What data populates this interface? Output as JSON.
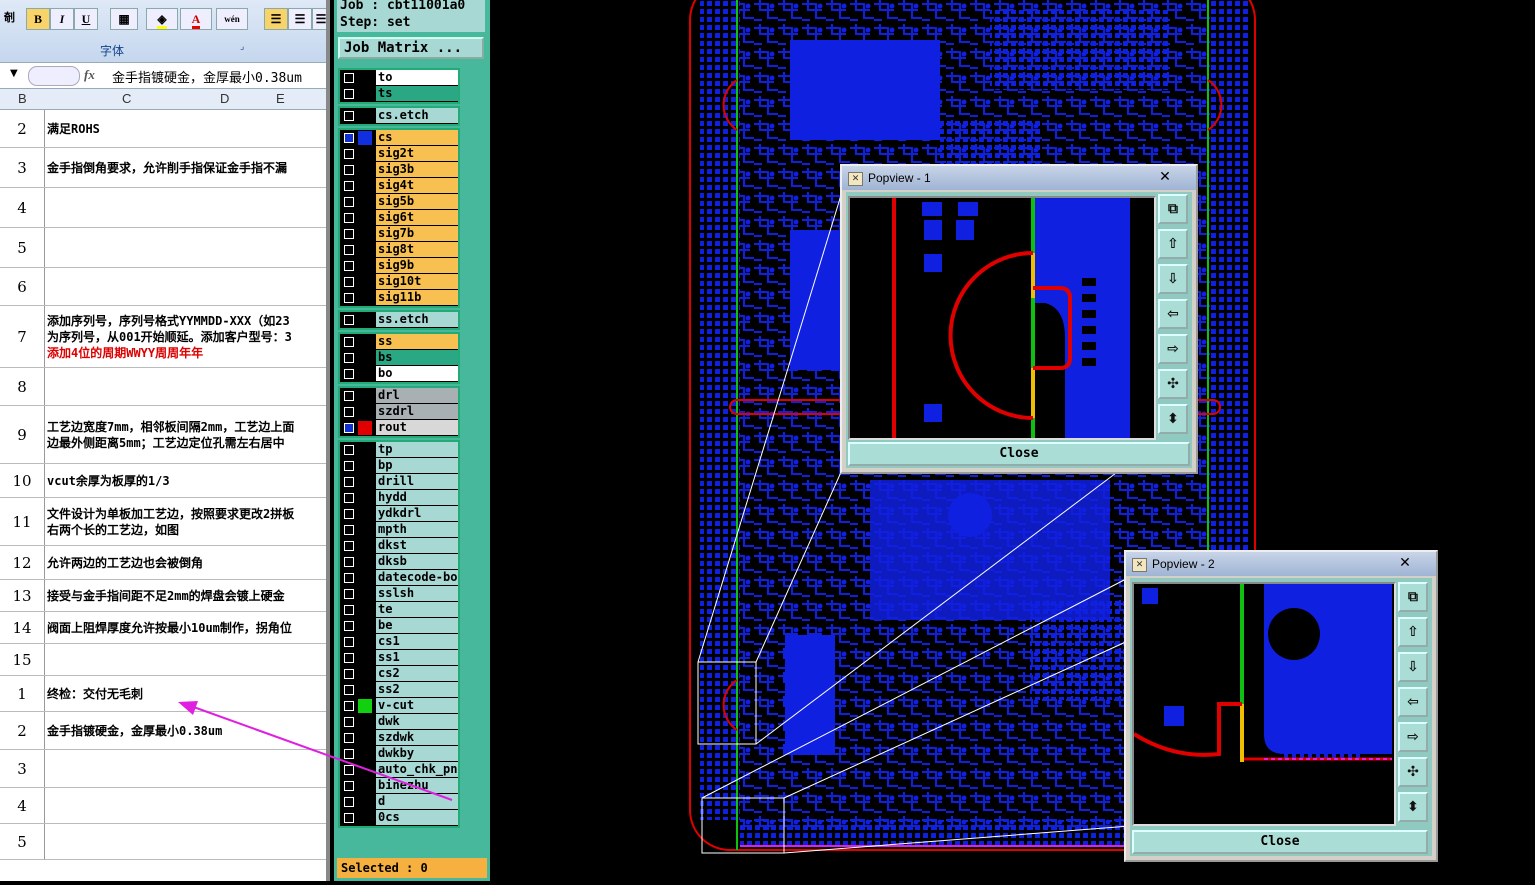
{
  "excel": {
    "ribbon": {
      "bold": "B",
      "italic": "I",
      "underline": "U",
      "font_color": "A",
      "phonetic": "wén",
      "group_font": "字体",
      "corner_label": "剞"
    },
    "formula_bar": {
      "fx": "fx",
      "value": "金手指镀硬金，金厚最小0.38um"
    },
    "columns": [
      "B",
      "C",
      "D",
      "E"
    ],
    "rows": [
      {
        "num": "2",
        "lines": [
          "满足ROHS"
        ]
      },
      {
        "num": "3",
        "lines": [
          "金手指倒角要求，允许削手指保证金手指不漏"
        ]
      },
      {
        "num": "4",
        "lines": [
          ""
        ]
      },
      {
        "num": "5",
        "lines": [
          ""
        ]
      },
      {
        "num": "6",
        "lines": [
          ""
        ]
      },
      {
        "num": "7",
        "lines": [
          "添加序列号，序列号格式YYMMDD-XXX（如23",
          "为序列号，从001开始顺延。添加客户型号：3"
        ],
        "red_line": "添加4位的周期WWYY周周年年"
      },
      {
        "num": "8",
        "lines": [
          ""
        ]
      },
      {
        "num": "9",
        "lines": [
          "工艺边宽度7mm，相邻板间隔2mm，工艺边上面",
          "边最外侧距离5mm；工艺边定位孔需左右居中"
        ]
      },
      {
        "num": "10",
        "lines": [
          "vcut余厚为板厚的1/3"
        ]
      },
      {
        "num": "11",
        "lines": [
          "文件设计为单板加工艺边，按照要求更改2拼板",
          "右两个长的工艺边，如图"
        ]
      },
      {
        "num": "12",
        "lines": [
          "允许两边的工艺边也会被倒角"
        ]
      },
      {
        "num": "13",
        "lines": [
          "接受与金手指间距不足2mm的焊盘会镀上硬金"
        ]
      },
      {
        "num": "14",
        "lines": [
          "阀面上阻焊厚度允许按最小10um制作，拐角位"
        ]
      },
      {
        "num": "15",
        "lines": [
          ""
        ]
      },
      {
        "num": "1",
        "lines": [
          "终检：交付无毛刺"
        ]
      },
      {
        "num": "2",
        "lines": [
          "金手指镀硬金，金厚最小0.38um"
        ]
      },
      {
        "num": "3",
        "lines": [
          ""
        ]
      },
      {
        "num": "4",
        "lines": [
          ""
        ]
      },
      {
        "num": "5",
        "lines": [
          ""
        ]
      }
    ]
  },
  "panel": {
    "job": "Job : cbt11001a0",
    "step": "Step: set",
    "job_matrix": "Job Matrix ...",
    "selected": "Selected : 0",
    "groups": [
      {
        "layers": [
          {
            "name": "to",
            "color": "#ffffff",
            "sw": ""
          },
          {
            "name": "ts",
            "color": "#2aa884",
            "sw": ""
          }
        ]
      },
      {
        "layers": [
          {
            "name": "cs.etch",
            "color": "#a7d8d4",
            "sw": ""
          }
        ]
      },
      {
        "layers": [
          {
            "name": "cs",
            "color": "#f8c050",
            "sw": "#1030e0",
            "checked": true
          },
          {
            "name": "sig2t",
            "color": "#f8c050",
            "sw": ""
          },
          {
            "name": "sig3b",
            "color": "#f8c050",
            "sw": ""
          },
          {
            "name": "sig4t",
            "color": "#f8c050",
            "sw": ""
          },
          {
            "name": "sig5b",
            "color": "#f8c050",
            "sw": ""
          },
          {
            "name": "sig6t",
            "color": "#f8c050",
            "sw": ""
          },
          {
            "name": "sig7b",
            "color": "#f8c050",
            "sw": ""
          },
          {
            "name": "sig8t",
            "color": "#f8c050",
            "sw": ""
          },
          {
            "name": "sig9b",
            "color": "#f8c050",
            "sw": ""
          },
          {
            "name": "sig10t",
            "color": "#f8c050",
            "sw": ""
          },
          {
            "name": "sig11b",
            "color": "#f8c050",
            "sw": ""
          }
        ]
      },
      {
        "layers": [
          {
            "name": "ss.etch",
            "color": "#a7d8d4",
            "sw": ""
          }
        ]
      },
      {
        "layers": [
          {
            "name": "ss",
            "color": "#f8c050",
            "sw": ""
          },
          {
            "name": "bs",
            "color": "#2aa884",
            "sw": ""
          },
          {
            "name": "bo",
            "color": "#ffffff",
            "sw": ""
          }
        ]
      },
      {
        "layers": [
          {
            "name": "drl",
            "color": "#a8b0b4",
            "sw": ""
          },
          {
            "name": "szdrl",
            "color": "#a8b0b4",
            "sw": ""
          },
          {
            "name": "rout",
            "color": "#d8d8d8",
            "sw": "#e00000",
            "checked": true
          }
        ]
      },
      {
        "layers": [
          {
            "name": "tp",
            "color": "#a7d8d4",
            "sw": ""
          },
          {
            "name": "bp",
            "color": "#a7d8d4",
            "sw": ""
          },
          {
            "name": "drill",
            "color": "#a7d8d4",
            "sw": ""
          },
          {
            "name": "hydd",
            "color": "#a7d8d4",
            "sw": ""
          },
          {
            "name": "ydkdrl",
            "color": "#a7d8d4",
            "sw": ""
          },
          {
            "name": "mpth",
            "color": "#a7d8d4",
            "sw": ""
          },
          {
            "name": "dkst",
            "color": "#a7d8d4",
            "sw": ""
          },
          {
            "name": "dksb",
            "color": "#a7d8d4",
            "sw": ""
          },
          {
            "name": "datecode-bo",
            "color": "#a7d8d4",
            "sw": ""
          },
          {
            "name": "sslsh",
            "color": "#a7d8d4",
            "sw": ""
          },
          {
            "name": "te",
            "color": "#a7d8d4",
            "sw": ""
          },
          {
            "name": "be",
            "color": "#a7d8d4",
            "sw": ""
          },
          {
            "name": "cs1",
            "color": "#a7d8d4",
            "sw": ""
          },
          {
            "name": "ss1",
            "color": "#a7d8d4",
            "sw": ""
          },
          {
            "name": "cs2",
            "color": "#a7d8d4",
            "sw": ""
          },
          {
            "name": "ss2",
            "color": "#a7d8d4",
            "sw": ""
          },
          {
            "name": "v-cut",
            "color": "#a7d8d4",
            "sw": "#10d010"
          },
          {
            "name": "dwk",
            "color": "#a7d8d4",
            "sw": ""
          },
          {
            "name": "szdwk",
            "color": "#a7d8d4",
            "sw": ""
          },
          {
            "name": "dwkby",
            "color": "#a7d8d4",
            "sw": ""
          },
          {
            "name": "auto_chk_pn",
            "color": "#a7d8d4",
            "sw": ""
          },
          {
            "name": "binezhu",
            "color": "#a7d8d4",
            "sw": ""
          },
          {
            "name": "d",
            "color": "#a7d8d4",
            "sw": ""
          },
          {
            "name": "0cs",
            "color": "#a7d8d4",
            "sw": ""
          }
        ]
      }
    ]
  },
  "popview1": {
    "title": "Popview - 1",
    "close_x": "✕",
    "close_label": "Close"
  },
  "popview2": {
    "title": "Popview - 2",
    "close_x": "✕",
    "close_label": "Close"
  },
  "tools": [
    "⧉",
    "⇧",
    "⇩",
    "⇦",
    "⇨",
    "✣",
    "⬍"
  ],
  "colors": {
    "copper": "#1020e0",
    "outline": "#e00000",
    "vcut": "#10c010",
    "gold": "#f0c000",
    "annotation": "#e020e0"
  }
}
